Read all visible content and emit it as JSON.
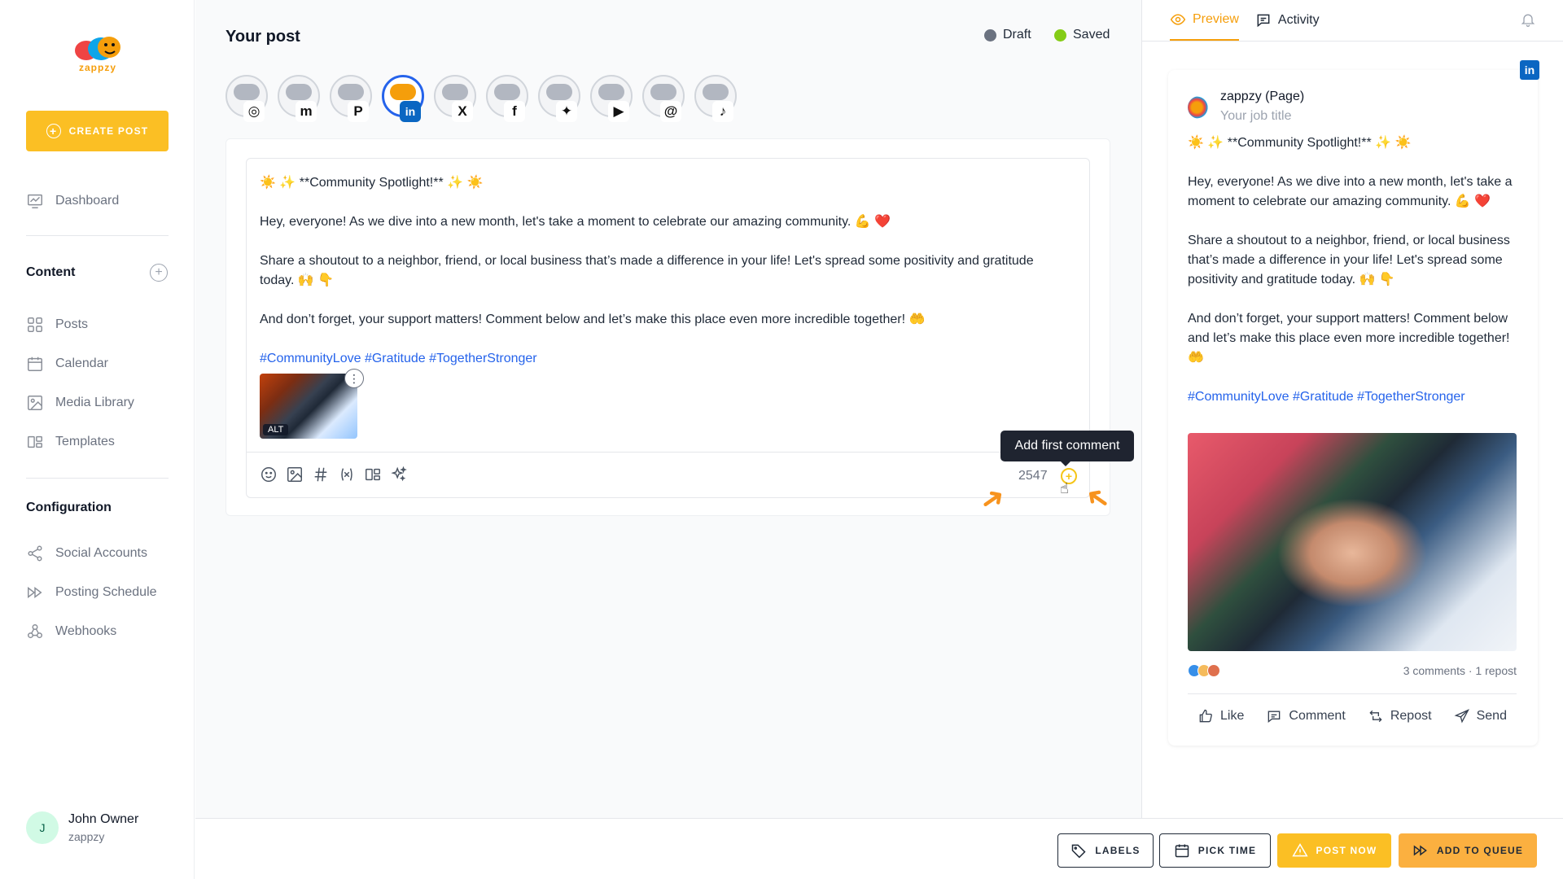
{
  "app": {
    "logo_text": "zappzy"
  },
  "sidebar": {
    "create_post": "CREATE POST",
    "dashboard": "Dashboard",
    "content_title": "Content",
    "content_items": [
      {
        "label": "Posts",
        "icon": "grid-icon"
      },
      {
        "label": "Calendar",
        "icon": "calendar-icon"
      },
      {
        "label": "Media Library",
        "icon": "image-icon"
      },
      {
        "label": "Templates",
        "icon": "templates-icon"
      }
    ],
    "config_title": "Configuration",
    "config_items": [
      {
        "label": "Social Accounts",
        "icon": "share-icon"
      },
      {
        "label": "Posting Schedule",
        "icon": "schedule-icon"
      },
      {
        "label": "Webhooks",
        "icon": "webhook-icon"
      }
    ],
    "user": {
      "initial": "J",
      "name": "John Owner",
      "org": "zappzy"
    }
  },
  "editor": {
    "title": "Your post",
    "status_draft": "Draft",
    "status_saved": "Saved",
    "accounts": [
      {
        "network": "instagram",
        "active": false
      },
      {
        "network": "mastodon",
        "active": false
      },
      {
        "network": "pinterest",
        "active": false
      },
      {
        "network": "linkedin",
        "active": true
      },
      {
        "network": "x",
        "active": false
      },
      {
        "network": "facebook",
        "active": false
      },
      {
        "network": "bluesky",
        "active": false
      },
      {
        "network": "youtube",
        "active": false
      },
      {
        "network": "threads",
        "active": false
      },
      {
        "network": "tiktok",
        "active": false
      }
    ],
    "post": {
      "line1": "☀️ ✨ **Community Spotlight!** ✨ ☀️",
      "line2": "Hey, everyone! As we dive into a new month, let's take a moment to celebrate our amazing community. 💪 ❤️",
      "line3": "Share a shoutout to a neighbor, friend, or local business that’s made a difference in your life! Let's spread some positivity and gratitude today. 🙌 👇",
      "line4": "And don’t forget, your support matters! Comment below and let’s make this place even more incredible together! 🤲",
      "hashtags": "#CommunityLove #Gratitude #TogetherStronger"
    },
    "image_alt_badge": "ALT",
    "char_count": "2547",
    "tooltip": "Add first comment"
  },
  "preview": {
    "tab_preview": "Preview",
    "tab_activity": "Activity",
    "page_name": "zappzy (Page)",
    "job_title": "Your job title",
    "line1": "☀️ ✨ **Community Spotlight!** ✨ ☀️",
    "line2": "Hey, everyone! As we dive into a new month, let's take a moment to celebrate our amazing community. 💪 ❤️",
    "line3": "Share a shoutout to a neighbor, friend, or local business that’s made a difference in your life! Let's spread some positivity and gratitude today. 🙌 👇",
    "line4": "And don’t forget, your support matters! Comment below and let’s make this place even more incredible together! 🤲",
    "hashtags": "#CommunityLove #Gratitude #TogetherStronger",
    "stats": "3 comments · 1 repost",
    "actions": {
      "like": "Like",
      "comment": "Comment",
      "repost": "Repost",
      "send": "Send"
    }
  },
  "bottom": {
    "labels": "LABELS",
    "pick_time": "PICK TIME",
    "post_now": "POST NOW",
    "add_to_queue": "ADD TO QUEUE"
  },
  "colors": {
    "accent": "#fbbf24",
    "draft_dot": "#6b7280",
    "saved_dot": "#84cc16",
    "linkedin": "#0a66c2",
    "hashtag": "#2563eb"
  }
}
